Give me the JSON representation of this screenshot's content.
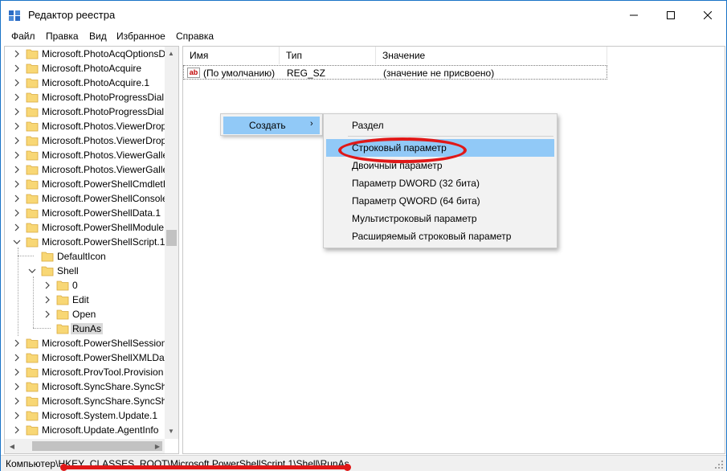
{
  "window": {
    "title": "Редактор реестра"
  },
  "menu": [
    "Файл",
    "Правка",
    "Вид",
    "Избранное",
    "Справка"
  ],
  "tree": [
    {
      "label": "Microsoft.PhotoAcqOptionsD",
      "level": 0,
      "expand": "closed"
    },
    {
      "label": "Microsoft.PhotoAcquire",
      "level": 0,
      "expand": "closed"
    },
    {
      "label": "Microsoft.PhotoAcquire.1",
      "level": 0,
      "expand": "closed"
    },
    {
      "label": "Microsoft.PhotoProgressDial",
      "level": 0,
      "expand": "closed"
    },
    {
      "label": "Microsoft.PhotoProgressDial",
      "level": 0,
      "expand": "closed"
    },
    {
      "label": "Microsoft.Photos.ViewerDrop",
      "level": 0,
      "expand": "closed"
    },
    {
      "label": "Microsoft.Photos.ViewerDrop",
      "level": 0,
      "expand": "closed"
    },
    {
      "label": "Microsoft.Photos.ViewerGalle",
      "level": 0,
      "expand": "closed"
    },
    {
      "label": "Microsoft.Photos.ViewerGalle",
      "level": 0,
      "expand": "closed"
    },
    {
      "label": "Microsoft.PowerShellCmdletI",
      "level": 0,
      "expand": "closed"
    },
    {
      "label": "Microsoft.PowerShellConsole",
      "level": 0,
      "expand": "closed"
    },
    {
      "label": "Microsoft.PowerShellData.1",
      "level": 0,
      "expand": "closed"
    },
    {
      "label": "Microsoft.PowerShellModule",
      "level": 0,
      "expand": "closed"
    },
    {
      "label": "Microsoft.PowerShellScript.1",
      "level": 0,
      "expand": "open"
    },
    {
      "label": "DefaultIcon",
      "level": 1,
      "expand": "none"
    },
    {
      "label": "Shell",
      "level": 1,
      "expand": "open"
    },
    {
      "label": "0",
      "level": 2,
      "expand": "closed"
    },
    {
      "label": "Edit",
      "level": 2,
      "expand": "closed"
    },
    {
      "label": "Open",
      "level": 2,
      "expand": "closed"
    },
    {
      "label": "RunAs",
      "level": 2,
      "expand": "none",
      "selected": true
    },
    {
      "label": "Microsoft.PowerShellSession",
      "level": 0,
      "expand": "closed"
    },
    {
      "label": "Microsoft.PowerShellXMLDat",
      "level": 0,
      "expand": "closed"
    },
    {
      "label": "Microsoft.ProvTool.Provision",
      "level": 0,
      "expand": "closed"
    },
    {
      "label": "Microsoft.SyncShare.SyncSha",
      "level": 0,
      "expand": "closed"
    },
    {
      "label": "Microsoft.SyncShare.SyncSha",
      "level": 0,
      "expand": "closed"
    },
    {
      "label": "Microsoft.System.Update.1",
      "level": 0,
      "expand": "closed"
    },
    {
      "label": "Microsoft.Update.AgentInfo",
      "level": 0,
      "expand": "closed"
    }
  ],
  "columns": {
    "name": "Имя",
    "type": "Тип",
    "value": "Значение"
  },
  "value_row": {
    "name": "(По умолчанию)",
    "type": "REG_SZ",
    "data": "(значение не присвоено)"
  },
  "context_menu": {
    "create": "Создать"
  },
  "submenu": {
    "section": "Раздел",
    "items": [
      "Строковый параметр",
      "Двоичный параметр",
      "Параметр DWORD (32 бита)",
      "Параметр QWORD (64 бита)",
      "Мультистроковый параметр",
      "Расширяемый строковый параметр"
    ]
  },
  "status": {
    "path": "Компьютер\\HKEY_CLASSES_ROOT\\Microsoft.PowerShellScript.1\\Shell\\RunAs"
  },
  "colors": {
    "highlight": "#91c9f7",
    "annotation": "#e01818",
    "folder": "#f8d775",
    "window_border": "#1a73c7"
  }
}
